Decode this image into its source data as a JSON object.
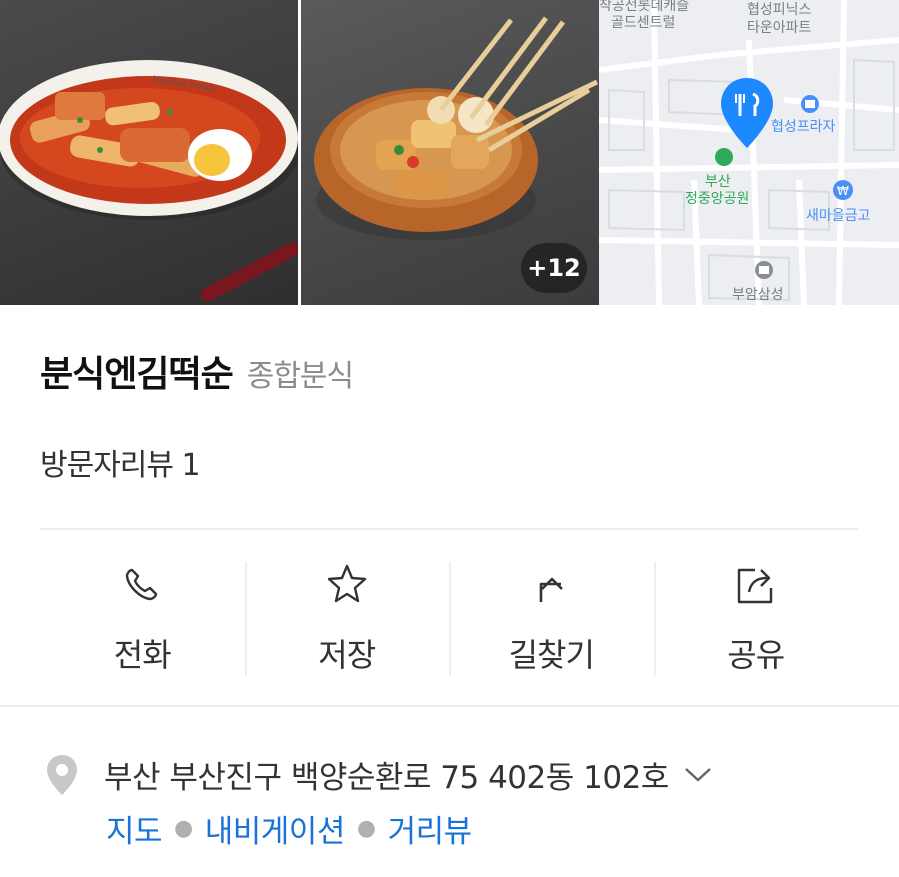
{
  "photos": {
    "more_count": "+12",
    "map_labels": {
      "top_left": "골드센트럴",
      "top_left_partial": "착공전롯데캐슬",
      "top_right_1": "협성피닉스",
      "top_right_2": "타운아파트",
      "plaza": "협성프라자",
      "park_1": "부산",
      "park_2": "정중앙공원",
      "bank": "새마을금고",
      "bottom": "부암삼성"
    }
  },
  "place": {
    "name": "분식엔김떡순",
    "category": "종합분식",
    "review": "방문자리뷰 1"
  },
  "actions": [
    {
      "label": "전화",
      "icon": "phone-icon"
    },
    {
      "label": "저장",
      "icon": "star-icon"
    },
    {
      "label": "길찾기",
      "icon": "directions-icon"
    },
    {
      "label": "공유",
      "icon": "share-icon"
    }
  ],
  "address": {
    "text": "부산 부산진구 백양순환로 75 402동 102호",
    "links": [
      "지도",
      "내비게이션",
      "거리뷰"
    ],
    "link_color": "#1a73d6"
  },
  "colors": {
    "map_pin": "#1e88ff",
    "park_green": "#2eaa5a",
    "poi_blue": "#4a8ff5"
  }
}
